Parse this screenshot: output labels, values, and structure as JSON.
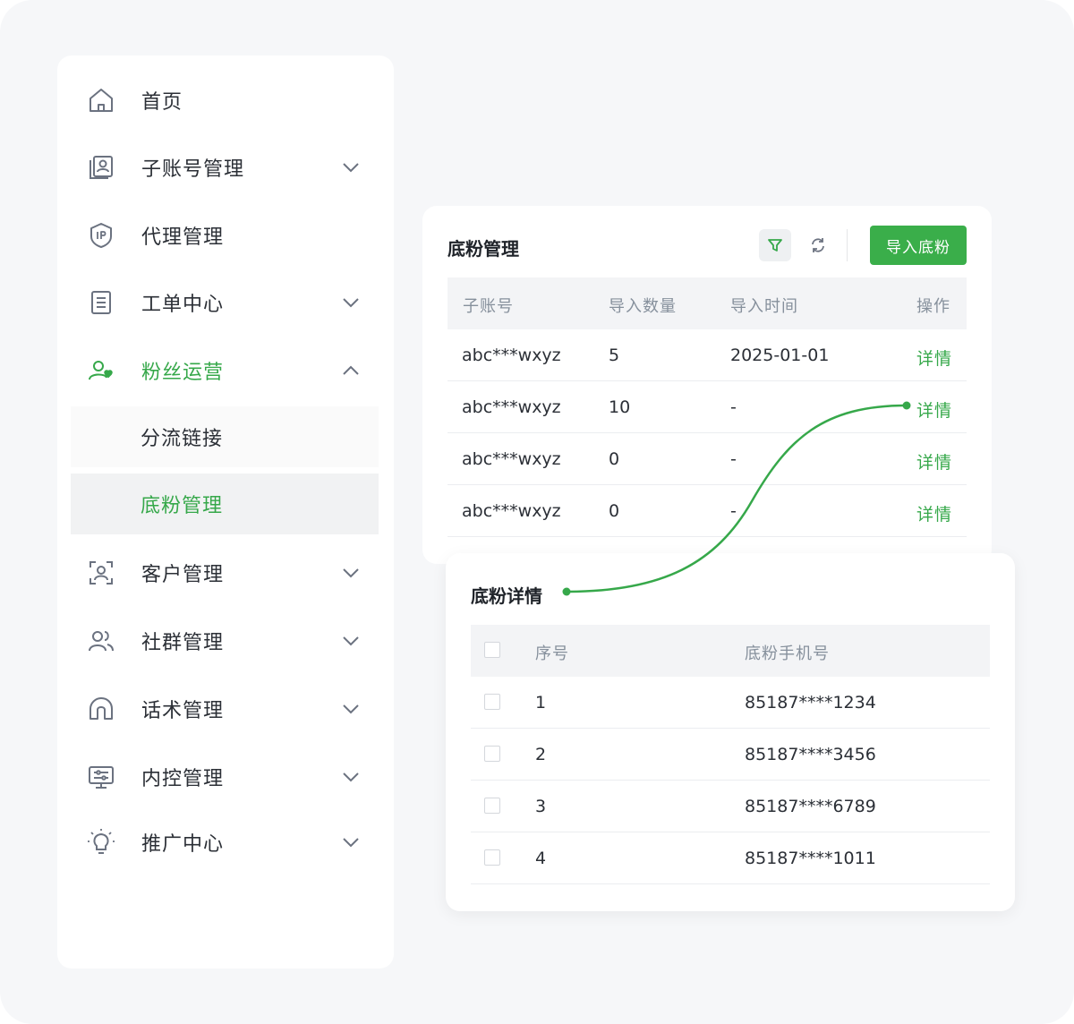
{
  "sidebar": {
    "items": [
      {
        "label": "首页",
        "icon": "home-icon"
      },
      {
        "label": "子账号管理",
        "icon": "account-card-icon"
      },
      {
        "label": "代理管理",
        "icon": "ip-shield-icon"
      },
      {
        "label": "工单中心",
        "icon": "document-list-icon"
      },
      {
        "label": "粉丝运营",
        "icon": "user-heart-icon"
      },
      {
        "label": "分流链接"
      },
      {
        "label": "底粉管理"
      },
      {
        "label": "客户管理",
        "icon": "face-scan-icon"
      },
      {
        "label": "社群管理",
        "icon": "group-users-icon"
      },
      {
        "label": "话术管理",
        "icon": "headset-icon"
      },
      {
        "label": "内控管理",
        "icon": "monitor-settings-icon"
      },
      {
        "label": "推广中心",
        "icon": "lightbulb-icon"
      }
    ]
  },
  "main": {
    "title": "底粉管理",
    "import_label": "导入底粉",
    "columns": [
      "子账号",
      "导入数量",
      "导入时间",
      "操作"
    ],
    "rows": [
      {
        "account": "abc***wxyz",
        "count": "5",
        "time": "2025-01-01",
        "action": "详情"
      },
      {
        "account": "abc***wxyz",
        "count": "10",
        "time": "-",
        "action": "详情"
      },
      {
        "account": "abc***wxyz",
        "count": "0",
        "time": "-",
        "action": "详情"
      },
      {
        "account": "abc***wxyz",
        "count": "0",
        "time": "-",
        "action": "详情"
      }
    ]
  },
  "detail": {
    "title": "底粉详情",
    "columns": [
      "序号",
      "底粉手机号"
    ],
    "rows": [
      {
        "index": "1",
        "phone": "85187****1234"
      },
      {
        "index": "2",
        "phone": "85187****3456"
      },
      {
        "index": "3",
        "phone": "85187****6789"
      },
      {
        "index": "4",
        "phone": "85187****1011"
      }
    ]
  },
  "colors": {
    "accent": "#36a84a",
    "text": "#2b2f36",
    "muted": "#86909c",
    "background": "#f6f7f9"
  }
}
